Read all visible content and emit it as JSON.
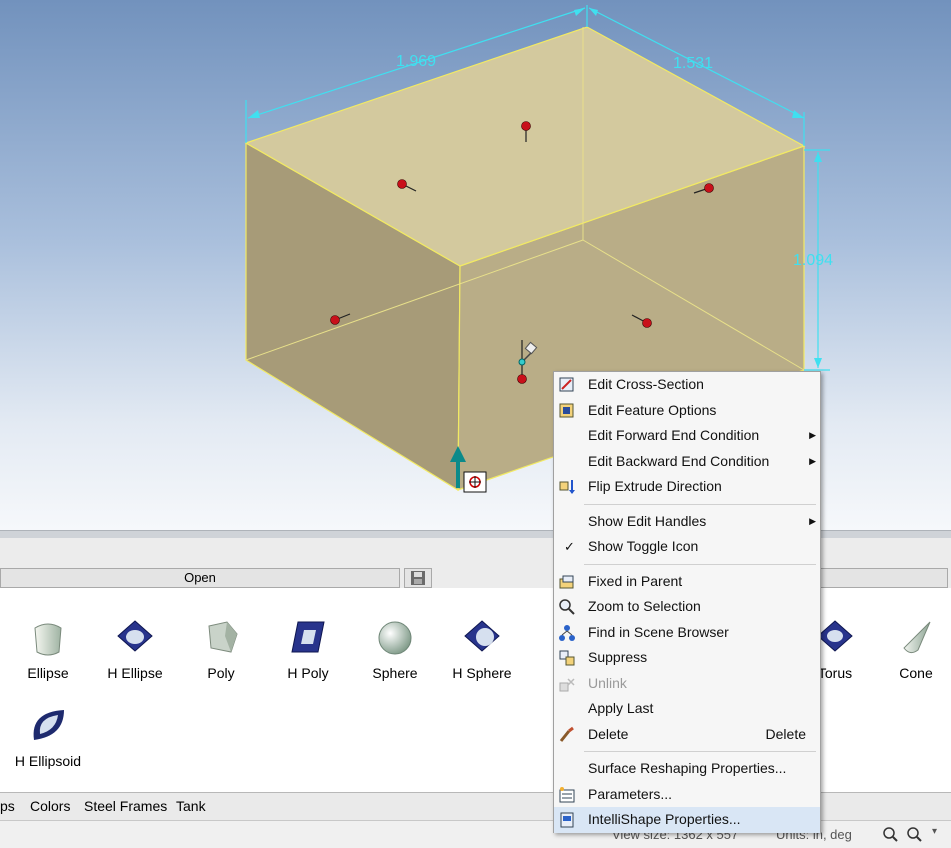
{
  "viewport": {
    "dimensions": {
      "width_label": "1.969",
      "depth_label": "1.531",
      "height_label": "1.094"
    }
  },
  "catalog_tabs": {
    "open_label": "Open"
  },
  "catalog": {
    "items": [
      {
        "label": "Ellipse",
        "icon": "ellipse-shape-icon"
      },
      {
        "label": "H Ellipse",
        "icon": "h-ellipse-shape-icon"
      },
      {
        "label": "Poly",
        "icon": "poly-shape-icon"
      },
      {
        "label": "H Poly",
        "icon": "h-poly-shape-icon"
      },
      {
        "label": "Sphere",
        "icon": "sphere-shape-icon"
      },
      {
        "label": "H Sphere",
        "icon": "h-sphere-shape-icon"
      },
      {
        "label": "Torus",
        "icon": "torus-shape-icon"
      },
      {
        "label": "Cone",
        "icon": "cone-shape-icon"
      },
      {
        "label": "H Ellipsoid",
        "icon": "h-ellipsoid-shape-icon"
      }
    ]
  },
  "bottom_tabs": [
    "ps",
    "Colors",
    "Steel Frames",
    "Tank"
  ],
  "status": {
    "view_size": "View size: 1362 x 557",
    "units": "Units: in, deg"
  },
  "context_menu": {
    "items": [
      {
        "label": "Edit Cross-Section",
        "icon": "cross-section-icon"
      },
      {
        "label": "Edit Feature Options",
        "icon": "feature-options-icon"
      },
      {
        "label": "Edit Forward End Condition",
        "submenu": true
      },
      {
        "label": "Edit Backward End Condition",
        "submenu": true
      },
      {
        "label": "Flip Extrude Direction",
        "icon": "flip-direction-icon"
      },
      {
        "label": "Show Edit Handles",
        "submenu": true
      },
      {
        "label": "Show Toggle Icon",
        "checked": true
      },
      {
        "label": "Fixed in Parent",
        "icon": "fixed-parent-icon"
      },
      {
        "label": "Zoom to Selection",
        "icon": "zoom-selection-icon"
      },
      {
        "label": "Find in Scene Browser",
        "icon": "scene-browser-icon"
      },
      {
        "label": "Suppress",
        "icon": "suppress-icon"
      },
      {
        "label": "Unlink",
        "icon": "unlink-icon",
        "disabled": true
      },
      {
        "label": "Apply Last"
      },
      {
        "label": "Delete",
        "icon": "delete-brush-icon",
        "shortcut": "Delete"
      },
      {
        "label": "Surface Reshaping Properties..."
      },
      {
        "label": "Parameters...",
        "icon": "parameters-icon"
      },
      {
        "label": "IntelliShape Properties...",
        "icon": "intellishape-properties-icon",
        "hover": true
      }
    ]
  }
}
